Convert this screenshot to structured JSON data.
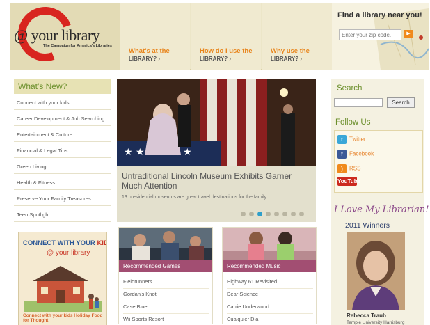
{
  "header": {
    "logo_text": "@ your library",
    "logo_tagline": "The Campaign for America's Libraries",
    "nav": [
      {
        "line1": "What's at the",
        "line2": "LIBRARY? ›"
      },
      {
        "line1": "How do I use the",
        "line2": "LIBRARY? ›"
      },
      {
        "line1": "Why use the",
        "line2": "LIBRARY? ›"
      }
    ],
    "finder_title": "Find a library near you!",
    "zip_placeholder": "Enter your zip code.",
    "zip_go": "▶"
  },
  "sidebar": {
    "heading": "What's New?",
    "items": [
      "Connect with your kids",
      "Career Development & Job Searching",
      "Entertainment & Culture",
      "Financial & Legal Tips",
      "Green Living",
      "Health & Fitness",
      "Preserve Your Family Treasures",
      "Teen Spotlight"
    ],
    "promo": {
      "line1_a": "CONNECT WITH YOUR ",
      "line1_b": "KIDS",
      "line2": "@ your library",
      "footer": "Connect with your kids Holiday Food for Thought"
    }
  },
  "hero": {
    "title": "Untraditional Lincoln Museum Exhibits Garner Much Attention",
    "subtitle": "13 presidential museums are great travel destinations for the family.",
    "slide_count": 8,
    "active_slide": 3
  },
  "games": {
    "heading": "Recommended Games",
    "items": [
      "Fieldrunners",
      "Gordan's Knot",
      "Case Blue",
      "Wii Sports Resort"
    ]
  },
  "music": {
    "heading": "Recommended Music",
    "items": [
      "Highway 61 Revisited",
      "Dear Science",
      "Carrie Underwood",
      "Cualquier Dia"
    ]
  },
  "right": {
    "search_heading": "Search",
    "search_button": "Search",
    "follow_heading": "Follow Us",
    "social": [
      {
        "icon": "twitter-icon",
        "label": "Twitter",
        "color": "#3aa7d8"
      },
      {
        "icon": "facebook-icon",
        "label": "Facebook",
        "color": "#3b5998"
      },
      {
        "icon": "rss-icon",
        "label": "RSS",
        "color": "#f08a1c"
      },
      {
        "icon": "youtube-icon",
        "label": "YouTube",
        "color": "#cc2a1f"
      }
    ],
    "ilove_title": "I Love My Librarian!",
    "winners_label": "2011 Winners",
    "winner_name": "Rebecca Traub",
    "winner_institution": "Temple University Harrisburg"
  },
  "colors": {
    "accent_green": "#6b8f2c",
    "accent_orange": "#e8851c",
    "card_bar": "#a24e72",
    "active_dot": "#2f9fca"
  }
}
